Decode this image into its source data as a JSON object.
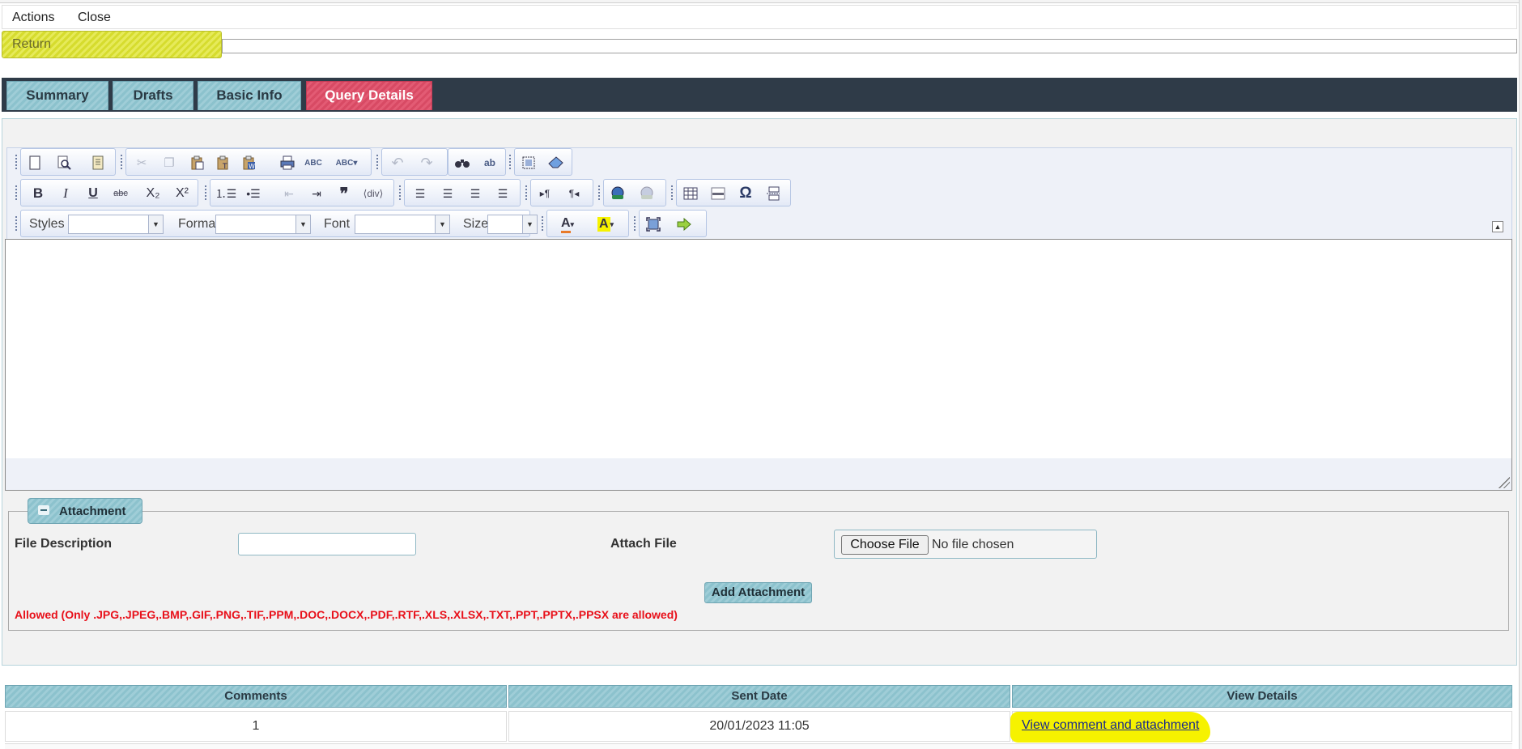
{
  "menu": {
    "actions": "Actions",
    "close": "Close",
    "return": "Return"
  },
  "tabs": [
    {
      "label": "Summary",
      "active": false
    },
    {
      "label": "Drafts",
      "active": false
    },
    {
      "label": "Basic Info",
      "active": false
    },
    {
      "label": "Query Details",
      "active": true
    }
  ],
  "editor": {
    "toolbar": {
      "styles_label": "Styles",
      "format_label": "Format",
      "font_label": "Font",
      "size_label": "Size"
    },
    "content": ""
  },
  "attachment": {
    "legend": "Attachment",
    "file_description_label": "File Description",
    "file_description_value": "",
    "attach_file_label": "Attach File",
    "choose_file_label": "Choose File",
    "no_file_text": "No file chosen",
    "add_button": "Add Attachment",
    "allowed_text": "Allowed (Only .JPG,.JPEG,.BMP,.GIF,.PNG,.TIF,.PPM,.DOC,.DOCX,.PDF,.RTF,.XLS,.XLSX,.TXT,.PPT,.PPTX,.PPSX are allowed)"
  },
  "grid": {
    "headers": [
      "Comments",
      "Sent Date",
      "View Details"
    ],
    "rows": [
      {
        "comments": "1",
        "sent_date": "20/01/2023 11:05",
        "view_details": "View comment and attachment"
      }
    ]
  },
  "colors": {
    "tab_active": "#d84a64",
    "tab_inactive": "#8cc2cd",
    "tabbar_bg": "#2f3b48",
    "return_highlight": "#d6dc2e",
    "allowed_text": "#e8101a",
    "link_highlight": "#f6f200"
  }
}
